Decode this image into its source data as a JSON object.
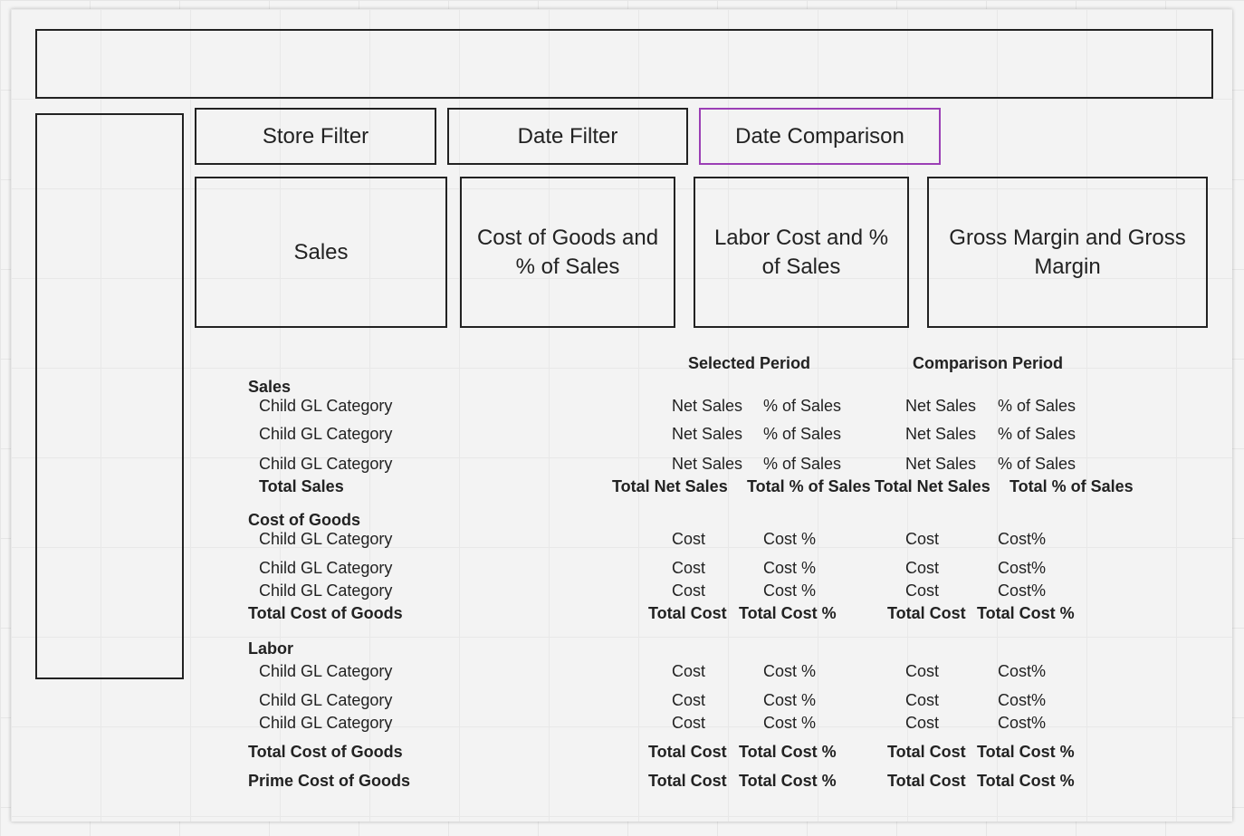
{
  "filters": {
    "store": "Store Filter",
    "date": "Date Filter",
    "comparison": "Date Comparison"
  },
  "tiles": {
    "sales": "Sales",
    "cogs": "Cost of Goods and % of Sales",
    "labor": "Labor Cost and % of Sales",
    "gross_margin": "Gross Margin and Gross Margin"
  },
  "table": {
    "headers": {
      "selected": "Selected Period",
      "comparison": "Comparison Period"
    },
    "sales": {
      "title": "Sales",
      "rows": [
        {
          "label": "Child GL Category",
          "c1": "Net Sales",
          "c2": "% of Sales",
          "c3": "Net Sales",
          "c4": "% of Sales"
        },
        {
          "label": "Child GL Category",
          "c1": "Net Sales",
          "c2": "% of Sales",
          "c3": "Net Sales",
          "c4": "% of Sales"
        },
        {
          "label": "Child GL Category",
          "c1": "Net Sales",
          "c2": "% of Sales",
          "c3": "Net Sales",
          "c4": "% of Sales"
        }
      ],
      "total": {
        "label": "Total Sales",
        "c1": "Total Net Sales",
        "c2": "Total % of Sales",
        "c3": "Total Net Sales",
        "c4": "Total % of Sales"
      }
    },
    "cogs": {
      "title": "Cost of Goods",
      "rows": [
        {
          "label": "Child GL Category",
          "c1": "Cost",
          "c2": "Cost %",
          "c3": "Cost",
          "c4": "Cost%"
        },
        {
          "label": "Child GL Category",
          "c1": "Cost",
          "c2": "Cost %",
          "c3": "Cost",
          "c4": "Cost%"
        },
        {
          "label": "Child GL Category",
          "c1": "Cost",
          "c2": "Cost %",
          "c3": "Cost",
          "c4": "Cost%"
        }
      ],
      "total": {
        "label": "Total Cost of Goods",
        "c1": "Total Cost",
        "c2": "Total Cost %",
        "c3": "Total Cost",
        "c4": "Total Cost %"
      }
    },
    "labor": {
      "title": "Labor",
      "rows": [
        {
          "label": "Child GL Category",
          "c1": "Cost",
          "c2": "Cost %",
          "c3": "Cost",
          "c4": "Cost%"
        },
        {
          "label": "Child GL Category",
          "c1": "Cost",
          "c2": "Cost %",
          "c3": "Cost",
          "c4": "Cost%"
        },
        {
          "label": "Child GL Category",
          "c1": "Cost",
          "c2": "Cost %",
          "c3": "Cost",
          "c4": "Cost%"
        }
      ],
      "total": {
        "label": "Total Cost of Goods",
        "c1": "Total Cost",
        "c2": "Total Cost %",
        "c3": "Total Cost",
        "c4": "Total Cost %"
      },
      "prime": {
        "label": "Prime Cost of Goods",
        "c1": "Total Cost",
        "c2": "Total Cost %",
        "c3": "Total Cost",
        "c4": "Total Cost %"
      }
    }
  }
}
